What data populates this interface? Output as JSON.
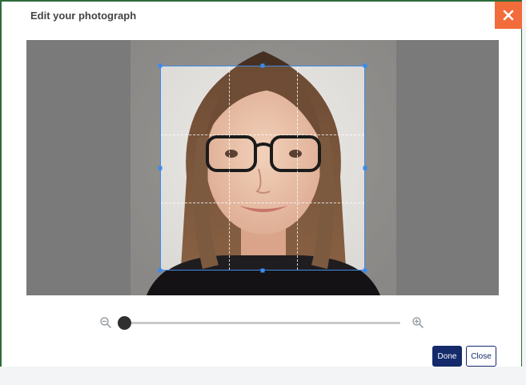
{
  "dialog": {
    "title": "Edit your photograph",
    "close_icon": "close-icon"
  },
  "photo": {
    "subject": "portrait-photo"
  },
  "zoom": {
    "level": 0.0,
    "zoom_out_icon": "zoom-out-icon",
    "zoom_in_icon": "zoom-in-icon"
  },
  "buttons": {
    "done_label": "Done",
    "close_label": "Close"
  },
  "colors": {
    "accent": "#f26b3a",
    "primary": "#142a6b",
    "crop": "#3b8bea"
  }
}
